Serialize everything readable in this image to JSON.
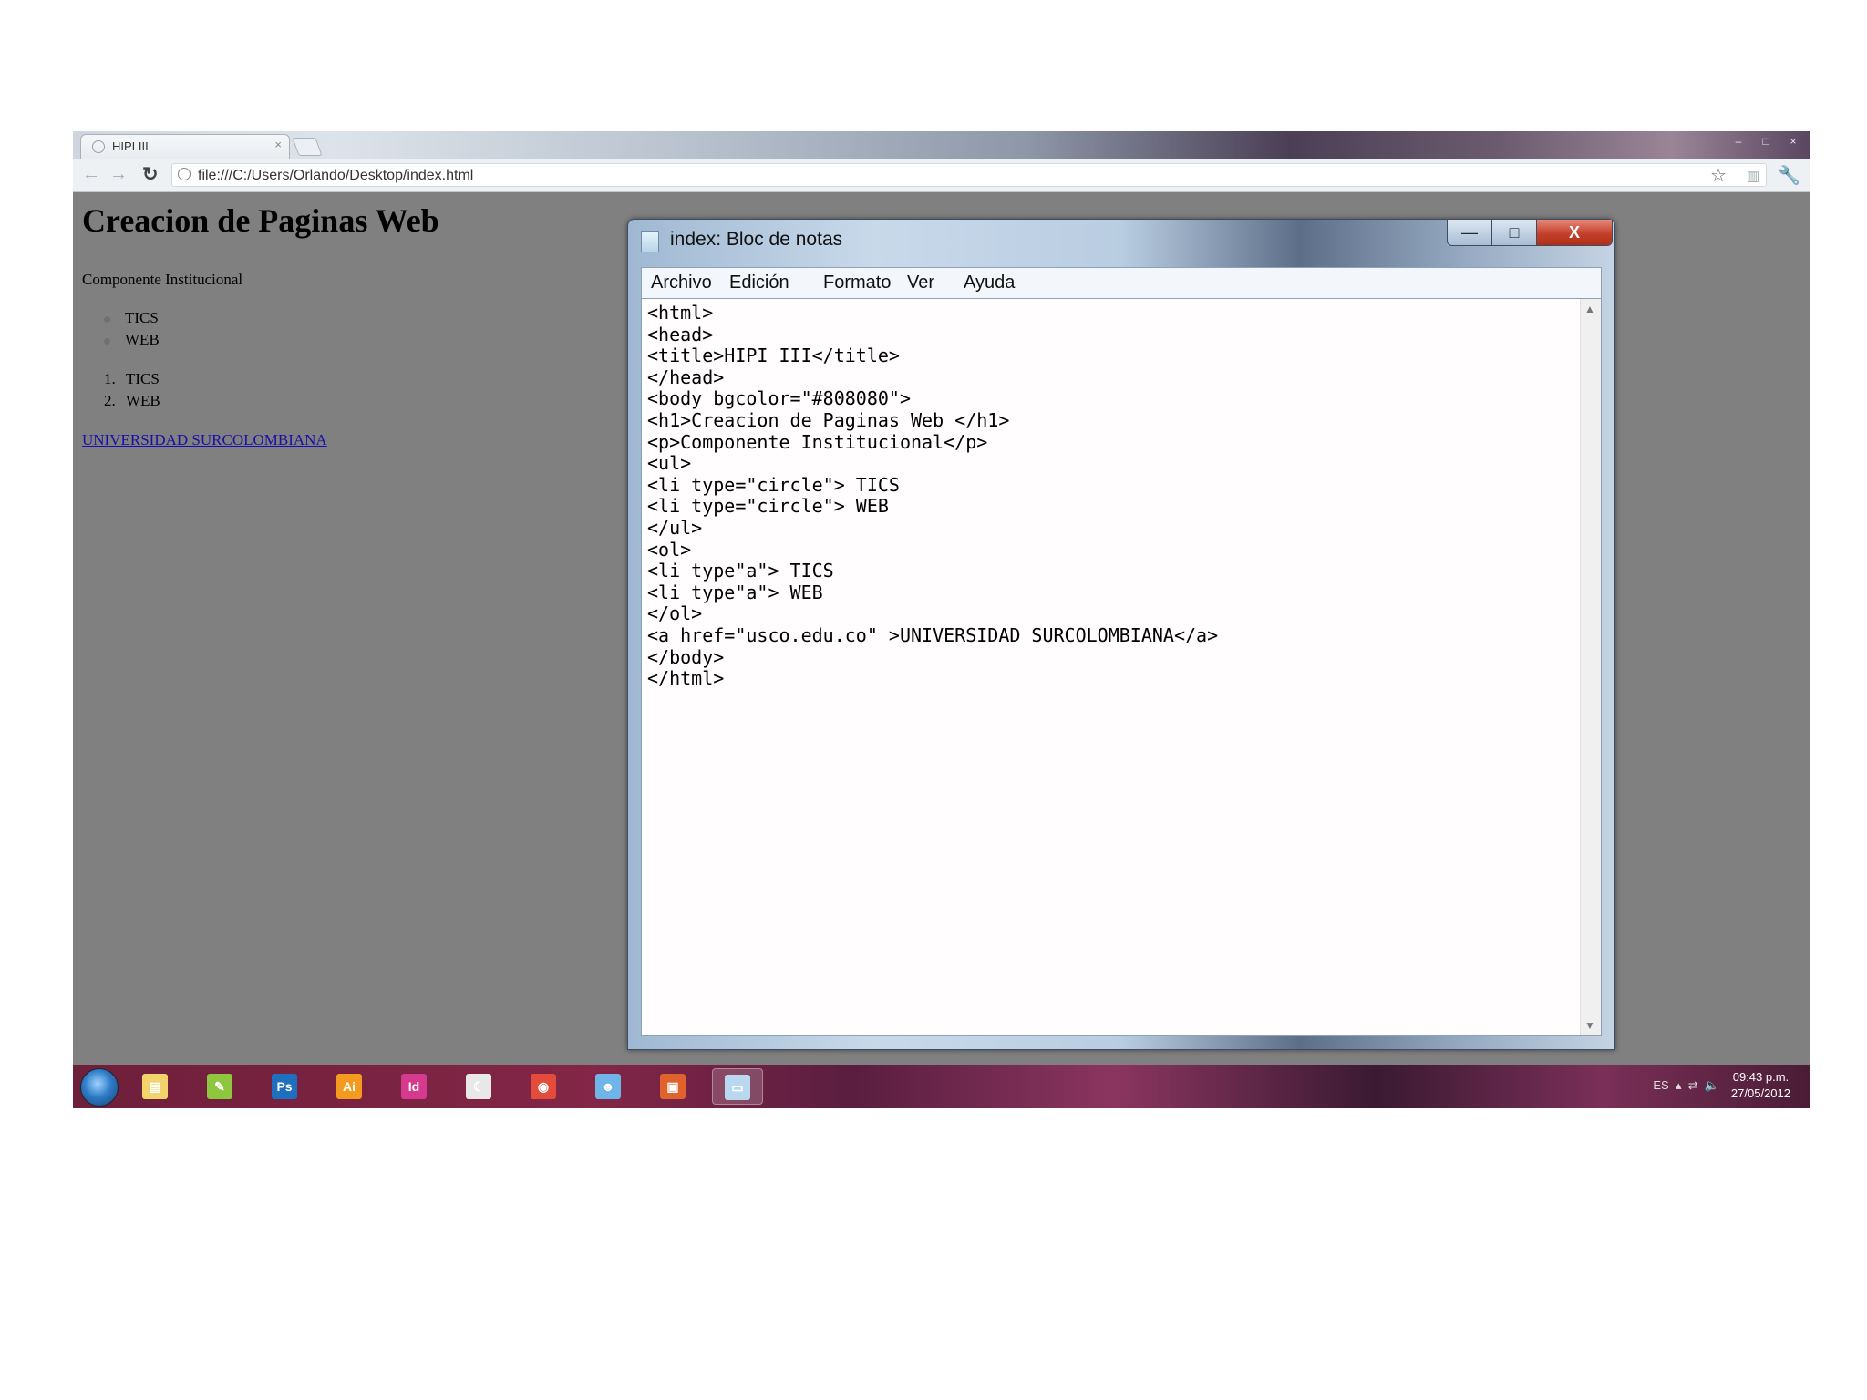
{
  "browser": {
    "tab_title": "HIPI III",
    "tab_close": "×",
    "url": "file:///C:/Users/Orlando/Desktop/index.html",
    "window_controls": [
      "–",
      "□",
      "×"
    ]
  },
  "page": {
    "heading": "Creacion de Paginas Web",
    "paragraph": "Componente Institucional",
    "unordered_items": [
      "TICS",
      "WEB"
    ],
    "ordered_items": [
      {
        "marker": "1.",
        "label": "TICS"
      },
      {
        "marker": "2.",
        "label": "WEB"
      }
    ],
    "link_text": "UNIVERSIDAD SURCOLOMBIANA",
    "background_color": "#808080"
  },
  "notepad": {
    "title": "index: Bloc de notas",
    "controls": {
      "minimize": "—",
      "maximize": "□",
      "close": "X"
    },
    "menu": [
      "Archivo",
      "Edición",
      "Formato",
      "Ver",
      "Ayuda"
    ],
    "code": "<html>\n<head>\n<title>HIPI III</title>\n</head>\n<body bgcolor=\"#808080\">\n<h1>Creacion de Paginas Web </h1>\n<p>Componente Institucional</p>\n<ul>\n<li type=\"circle\"> TICS\n<li type=\"circle\"> WEB\n</ul>\n<ol>\n<li type\"a\"> TICS\n<li type\"a\"> WEB\n</ol>\n<a href=\"usco.edu.co\" >UNIVERSIDAD SURCOLOMBIANA</a>\n</body>\n</html>"
  },
  "taskbar": {
    "apps": [
      {
        "name": "explorer",
        "glyph": "▤",
        "color": "#f3d36b"
      },
      {
        "name": "evernote",
        "glyph": "✎",
        "color": "#8ec63f"
      },
      {
        "name": "photoshop",
        "glyph": "Ps",
        "color": "#1f6fbf"
      },
      {
        "name": "illustrator",
        "glyph": "Ai",
        "color": "#f39a1f"
      },
      {
        "name": "indesign",
        "glyph": "Id",
        "color": "#d63a8e"
      },
      {
        "name": "moon-app",
        "glyph": "☾",
        "color": "#e8e8e8"
      },
      {
        "name": "chrome",
        "glyph": "◉",
        "color": "#e34b3b"
      },
      {
        "name": "messenger",
        "glyph": "☻",
        "color": "#6fb5e8"
      },
      {
        "name": "powerpoint",
        "glyph": "▣",
        "color": "#e0622c"
      },
      {
        "name": "notepad",
        "glyph": "▭",
        "color": "#b9d8ef"
      }
    ],
    "language": "ES",
    "time": "09:43 p.m.",
    "date": "27/05/2012"
  }
}
